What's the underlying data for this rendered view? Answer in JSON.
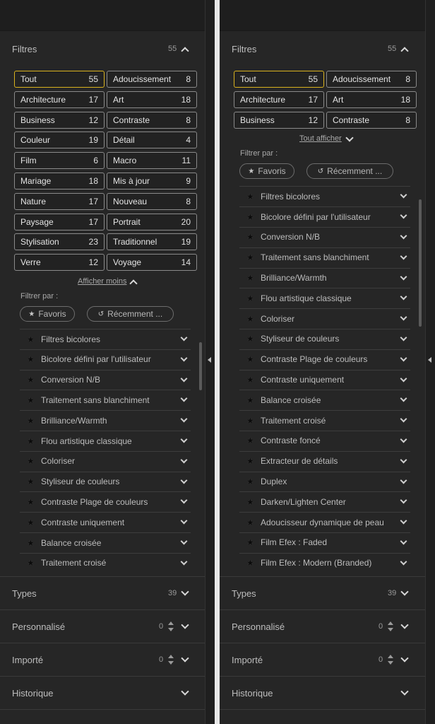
{
  "filters_section": {
    "title": "Filtres",
    "count": "55"
  },
  "tags": [
    {
      "label": "Tout",
      "count": "55",
      "active": true
    },
    {
      "label": "Adoucissement",
      "count": "8"
    },
    {
      "label": "Architecture",
      "count": "17"
    },
    {
      "label": "Art",
      "count": "18"
    },
    {
      "label": "Business",
      "count": "12"
    },
    {
      "label": "Contraste",
      "count": "8"
    },
    {
      "label": "Couleur",
      "count": "19"
    },
    {
      "label": "Détail",
      "count": "4"
    },
    {
      "label": "Film",
      "count": "6"
    },
    {
      "label": "Macro",
      "count": "11"
    },
    {
      "label": "Mariage",
      "count": "18"
    },
    {
      "label": "Mis à jour",
      "count": "9"
    },
    {
      "label": "Nature",
      "count": "17"
    },
    {
      "label": "Nouveau",
      "count": "8"
    },
    {
      "label": "Paysage",
      "count": "17"
    },
    {
      "label": "Portrait",
      "count": "20"
    },
    {
      "label": "Stylisation",
      "count": "23"
    },
    {
      "label": "Traditionnel",
      "count": "19"
    },
    {
      "label": "Verre",
      "count": "12"
    },
    {
      "label": "Voyage",
      "count": "14"
    }
  ],
  "show_less": "Afficher moins",
  "show_all": "Tout afficher",
  "filter_by": "Filtrer par :",
  "pill_favorites": "Favoris",
  "pill_recent": "Récemment ...",
  "filters": [
    "Filtres bicolores",
    "Bicolore défini par l'utilisateur",
    "Conversion N/B",
    "Traitement sans blanchiment",
    "Brilliance/Warmth",
    "Flou artistique classique",
    "Coloriser",
    "Styliseur de couleurs",
    "Contraste Plage de couleurs",
    "Contraste uniquement",
    "Balance croisée",
    "Traitement croisé",
    "Contraste foncé",
    "Extracteur de détails",
    "Duplex",
    "Darken/Lighten Center",
    "Adoucisseur dynamique de peau",
    "Film Efex : Faded",
    "Film Efex : Modern (Branded)"
  ],
  "bottom_sections": [
    {
      "title": "Types",
      "count": "39",
      "stepper": false
    },
    {
      "title": "Personnalisé",
      "count": "0",
      "stepper": true
    },
    {
      "title": "Importé",
      "count": "0",
      "stepper": true
    },
    {
      "title": "Historique",
      "count": "",
      "stepper": false
    }
  ],
  "colors": {
    "panel": "#262626",
    "accent": "#d9b21f"
  },
  "icons": [
    "chevron-up-icon",
    "chevron-down-icon",
    "star-icon",
    "history-icon",
    "collapse-arrow-icon",
    "stepper-icon"
  ]
}
